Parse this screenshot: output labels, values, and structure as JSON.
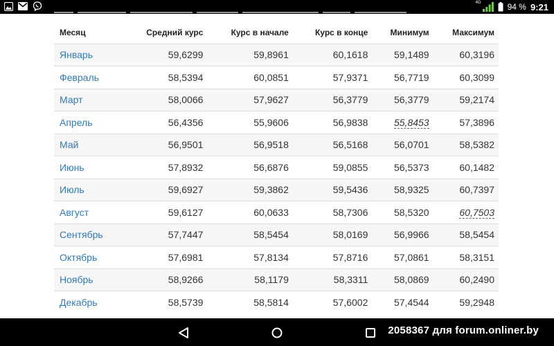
{
  "status_bar": {
    "network": "4G",
    "battery": "94 %",
    "time": "9:21"
  },
  "table": {
    "headers": [
      "Месяц",
      "Средний курс",
      "Курс в начале",
      "Курс в конце",
      "Минимум",
      "Максимум"
    ],
    "rows": [
      {
        "month": "Январь",
        "avg": "59,6299",
        "start": "59,8961",
        "end": "60,1618",
        "min": "59,1489",
        "max": "60,3196"
      },
      {
        "month": "Февраль",
        "avg": "58,5394",
        "start": "60,0851",
        "end": "57,9371",
        "min": "56,7719",
        "max": "60,3099"
      },
      {
        "month": "Март",
        "avg": "58,0066",
        "start": "57,9627",
        "end": "56,3779",
        "min": "56,3779",
        "max": "59,2174"
      },
      {
        "month": "Апрель",
        "avg": "56,4356",
        "start": "55,9606",
        "end": "56,9838",
        "min": "55,8453",
        "max": "57,3896"
      },
      {
        "month": "Май",
        "avg": "56,9501",
        "start": "56,9518",
        "end": "56,5168",
        "min": "56,0701",
        "max": "58,5382"
      },
      {
        "month": "Июнь",
        "avg": "57,8932",
        "start": "56,6876",
        "end": "59,0855",
        "min": "56,5373",
        "max": "60,1482"
      },
      {
        "month": "Июль",
        "avg": "59,6927",
        "start": "59,3862",
        "end": "59,5436",
        "min": "58,9325",
        "max": "60,7397"
      },
      {
        "month": "Август",
        "avg": "59,6127",
        "start": "60,0633",
        "end": "58,7306",
        "min": "58,5320",
        "max": "60,7503"
      },
      {
        "month": "Сентябрь",
        "avg": "57,7447",
        "start": "58,5454",
        "end": "58,0169",
        "min": "56,9966",
        "max": "58,5454"
      },
      {
        "month": "Октябрь",
        "avg": "57,6981",
        "start": "57,8134",
        "end": "57,8716",
        "min": "57,0861",
        "max": "58,3151"
      },
      {
        "month": "Ноябрь",
        "avg": "58,9266",
        "start": "58,1179",
        "end": "58,3311",
        "min": "58,0869",
        "max": "60,2490"
      },
      {
        "month": "Декабрь",
        "avg": "58,5739",
        "start": "58,5814",
        "end": "57,6002",
        "min": "57,4544",
        "max": "59,2948"
      }
    ]
  },
  "watermark": "2058367 для forum.onliner.by",
  "colors": {
    "link": "#2f7bbf",
    "row_stripe": "#f6f6f6",
    "signal": "#6ad03a"
  }
}
